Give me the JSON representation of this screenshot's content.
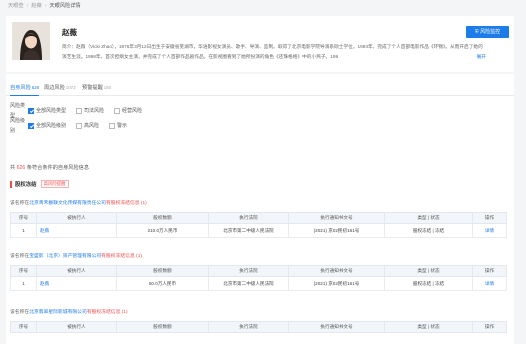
{
  "breadcrumb": {
    "home": "天眼查",
    "parent": "赵薇",
    "current": "天眼风险详情"
  },
  "profile": {
    "name": "赵薇",
    "bio": "简介：赵薇（Vicki Zhao），1976年3月12日出生于安徽省芜湖市，华语影视女演员、歌手、导演、监制。取得了北京电影学院导演系硕士学位。1993年，完成了个人首部电影作品《环锦》。从而开启了她的演艺生涯。1998年，首次担纲女主演，并完成了个人首部作品剧作品，在影视圈看到了她所扮演的角色《还珠格格》中的小燕子。199",
    "more": "展开",
    "risk_button": "风险监控"
  },
  "tabs": [
    {
      "label": "自身风险",
      "count": "626"
    },
    {
      "label": "周边风险",
      "count": "1073"
    },
    {
      "label": "预警提醒",
      "count": "160"
    }
  ],
  "filters": {
    "type": {
      "label": "风险类型",
      "options": [
        "全部风险类型",
        "司法风险",
        "经营风险"
      ]
    },
    "level": {
      "label": "风险级别",
      "options": [
        "全部风险级别",
        "高风险",
        "警示"
      ]
    }
  },
  "summary": {
    "prefix": "共",
    "count": "626",
    "suffix": "条符合条件的自身风险信息"
  },
  "section": {
    "title": "股权冻结",
    "badge": "高风险提醒"
  },
  "columns": [
    "序号",
    "被执行人",
    "股权数额",
    "执行法院",
    "执行通知书文号",
    "类型 | 状态",
    "操作"
  ],
  "groups": [
    {
      "prefix": "该名称在",
      "company": "北京青禾群联文化传媒有限责任公司",
      "suffix": "有股权冻结信息",
      "count": "(1)",
      "rows": [
        {
          "no": "1",
          "person": "赵薇",
          "amount": "210.0万人民币",
          "court": "北京市第二中级人民法院",
          "doc": "(2021) 京02民初161号",
          "type": "股权冻结 | 冻结",
          "action": "详情"
        }
      ]
    },
    {
      "prefix": "该名称在",
      "company": "宝盛影（北京）资产管理有限公司",
      "suffix": "有股权冻结信息",
      "count": "(1)",
      "rows": [
        {
          "no": "1",
          "person": "赵薇",
          "amount": "50.0万人民币",
          "court": "北京市第二中级人民法院",
          "doc": "(2021) 京02民初161号",
          "type": "股权冻结 | 冻结",
          "action": "详情"
        }
      ]
    },
    {
      "prefix": "该名称在",
      "company": "北京翡翠星际影城有限公司",
      "suffix": "有股权冻结信息",
      "count": "(1)",
      "rows": []
    }
  ],
  "colors": {
    "accent": "#1e7ce8",
    "danger": "#f04f4f"
  }
}
